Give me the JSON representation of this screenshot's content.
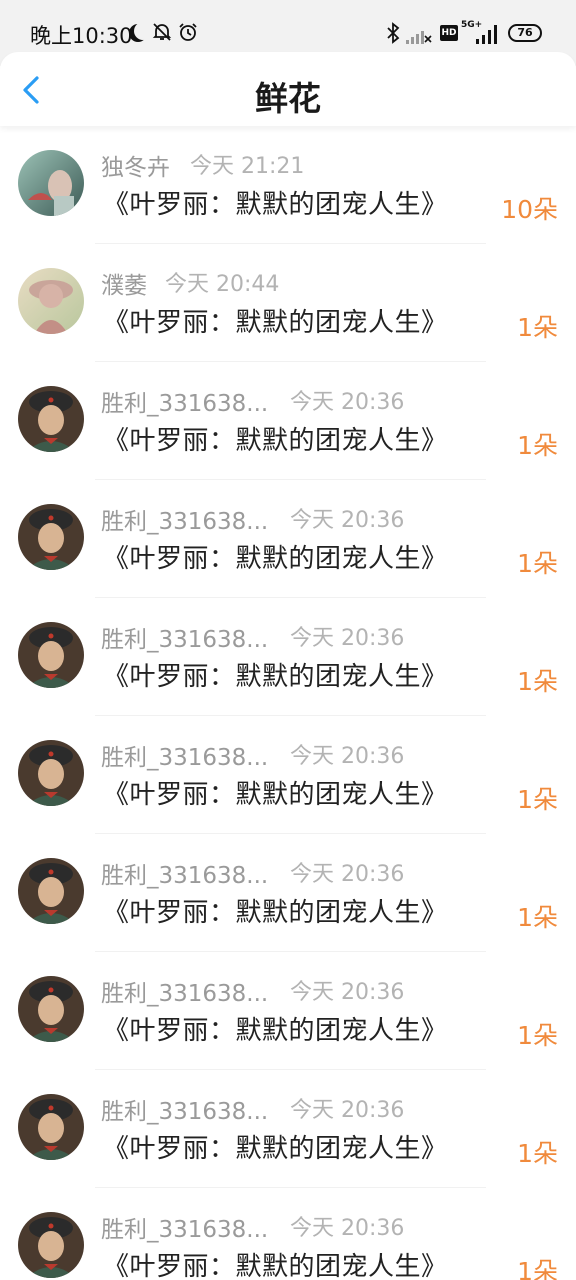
{
  "status_bar": {
    "time": "晚上10:30",
    "hd": "HD",
    "network": "5G+",
    "battery": "76"
  },
  "header": {
    "back_icon": "chevron-left-icon",
    "title": "鲜花"
  },
  "colors": {
    "accent": "#f08a3c",
    "back": "#2a9df4",
    "muted": "#9a9a9a"
  },
  "list": [
    {
      "name": "独冬卉",
      "time": "今天 21:21",
      "book": "《叶罗丽：默默的团宠人生》",
      "count": "10朵",
      "avatar": "avatar-photo-1"
    },
    {
      "name": "濮萎",
      "time": "今天 20:44",
      "book": "《叶罗丽：默默的团宠人生》",
      "count": "1朵",
      "avatar": "avatar-photo-2"
    },
    {
      "name": "胜利_331638...",
      "time": "今天 20:36",
      "book": "《叶罗丽：默默的团宠人生》",
      "count": "1朵",
      "avatar": "avatar-photo-3"
    },
    {
      "name": "胜利_331638...",
      "time": "今天 20:36",
      "book": "《叶罗丽：默默的团宠人生》",
      "count": "1朵",
      "avatar": "avatar-photo-3"
    },
    {
      "name": "胜利_331638...",
      "time": "今天 20:36",
      "book": "《叶罗丽：默默的团宠人生》",
      "count": "1朵",
      "avatar": "avatar-photo-3"
    },
    {
      "name": "胜利_331638...",
      "time": "今天 20:36",
      "book": "《叶罗丽：默默的团宠人生》",
      "count": "1朵",
      "avatar": "avatar-photo-3"
    },
    {
      "name": "胜利_331638...",
      "time": "今天 20:36",
      "book": "《叶罗丽：默默的团宠人生》",
      "count": "1朵",
      "avatar": "avatar-photo-3"
    },
    {
      "name": "胜利_331638...",
      "time": "今天 20:36",
      "book": "《叶罗丽：默默的团宠人生》",
      "count": "1朵",
      "avatar": "avatar-photo-3"
    },
    {
      "name": "胜利_331638...",
      "time": "今天 20:36",
      "book": "《叶罗丽：默默的团宠人生》",
      "count": "1朵",
      "avatar": "avatar-photo-3"
    },
    {
      "name": "胜利_331638...",
      "time": "今天 20:36",
      "book": "《叶罗丽：默默的团宠人生》",
      "count": "1朵",
      "avatar": "avatar-photo-3"
    }
  ]
}
